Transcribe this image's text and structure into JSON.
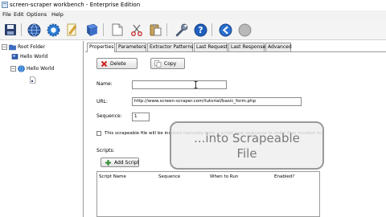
{
  "window": {
    "title": "screen-scraper workbench - Enterprise Edition"
  },
  "menu": [
    "File",
    "Edit",
    "Options",
    "Help"
  ],
  "toolbar": {
    "icons": [
      "save-icon",
      "globe-icon",
      "gear-icon",
      "pencil-icon",
      "book-icon",
      "new-document-icon",
      "cut-icon",
      "paste-icon",
      "wrench-icon",
      "help-icon",
      "back-arrow-icon",
      "stop-icon"
    ]
  },
  "tree": {
    "root": "Root Folder",
    "items": [
      "Hello World",
      "Hello World"
    ]
  },
  "tabs": [
    "Properties",
    "Parameters",
    "Extractor Patterns",
    "Last Request",
    "Last Response",
    "Advanced"
  ],
  "properties": {
    "delete_label": "Delete",
    "copy_label": "Copy",
    "name_label": "Name:",
    "name_value": "",
    "url_label": "URL:",
    "url_value": "http://www.screen-scraper.com/tutorial/basic_form.php",
    "sequence_label": "Sequence:",
    "sequence_value": "1",
    "scrapeable_checkbox_label": "This scrapeable file will be invoked manually from a script (use sequence to order files invoked manually).",
    "scripts_label": "Scripts:",
    "add_script_label": "Add Script",
    "script_columns": [
      "Script Name",
      "Sequence",
      "When to Run",
      "Enabled?"
    ]
  },
  "overlay": {
    "line1": "...into Scrapeable",
    "line2": "File"
  },
  "colors": {
    "overlay_text": "#7a7a7a",
    "overlay_border": "#9a9a9a",
    "tab_border": "#9a9a9a"
  }
}
